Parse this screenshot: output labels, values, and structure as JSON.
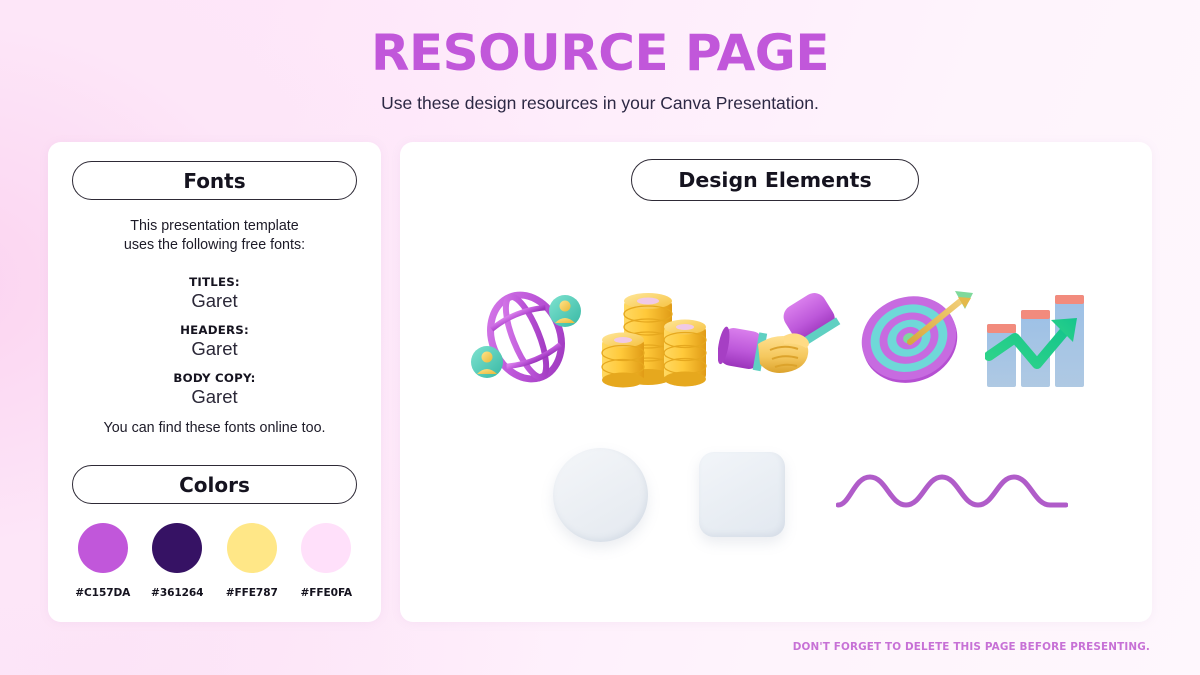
{
  "header": {
    "title": "RESOURCE PAGE",
    "subtitle": "Use these design resources in your Canva Presentation.",
    "title_color": "#C157DA"
  },
  "fonts_panel": {
    "heading": "Fonts",
    "intro": "This presentation template\nuses the following free fonts:",
    "groups": [
      {
        "label": "TITLES:",
        "font": "Garet"
      },
      {
        "label": "HEADERS:",
        "font": "Garet"
      },
      {
        "label": "BODY COPY:",
        "font": "Garet"
      }
    ],
    "outro": "You can find these fonts online too."
  },
  "colors_panel": {
    "heading": "Colors",
    "swatches": [
      {
        "hex": "#C157DA",
        "label": "#C157DA"
      },
      {
        "hex": "#361264",
        "label": "#361264"
      },
      {
        "hex": "#FFE787",
        "label": "#FFE787"
      },
      {
        "hex": "#FFE0FA",
        "label": "#FFE0FA"
      }
    ]
  },
  "elements_panel": {
    "heading": "Design Elements",
    "items": [
      {
        "name": "globe-network-3d-illustration"
      },
      {
        "name": "coin-stacks-3d-illustration"
      },
      {
        "name": "handshake-3d-illustration"
      },
      {
        "name": "target-arrow-3d-illustration"
      },
      {
        "name": "growth-bar-chart-3d-illustration"
      },
      {
        "name": "soft-circle-shape"
      },
      {
        "name": "soft-rounded-square-shape"
      },
      {
        "name": "purple-wave-line"
      }
    ]
  },
  "footer": {
    "note": "DON'T FORGET TO DELETE THIS PAGE BEFORE PRESENTING.",
    "color": "#C771D6"
  }
}
